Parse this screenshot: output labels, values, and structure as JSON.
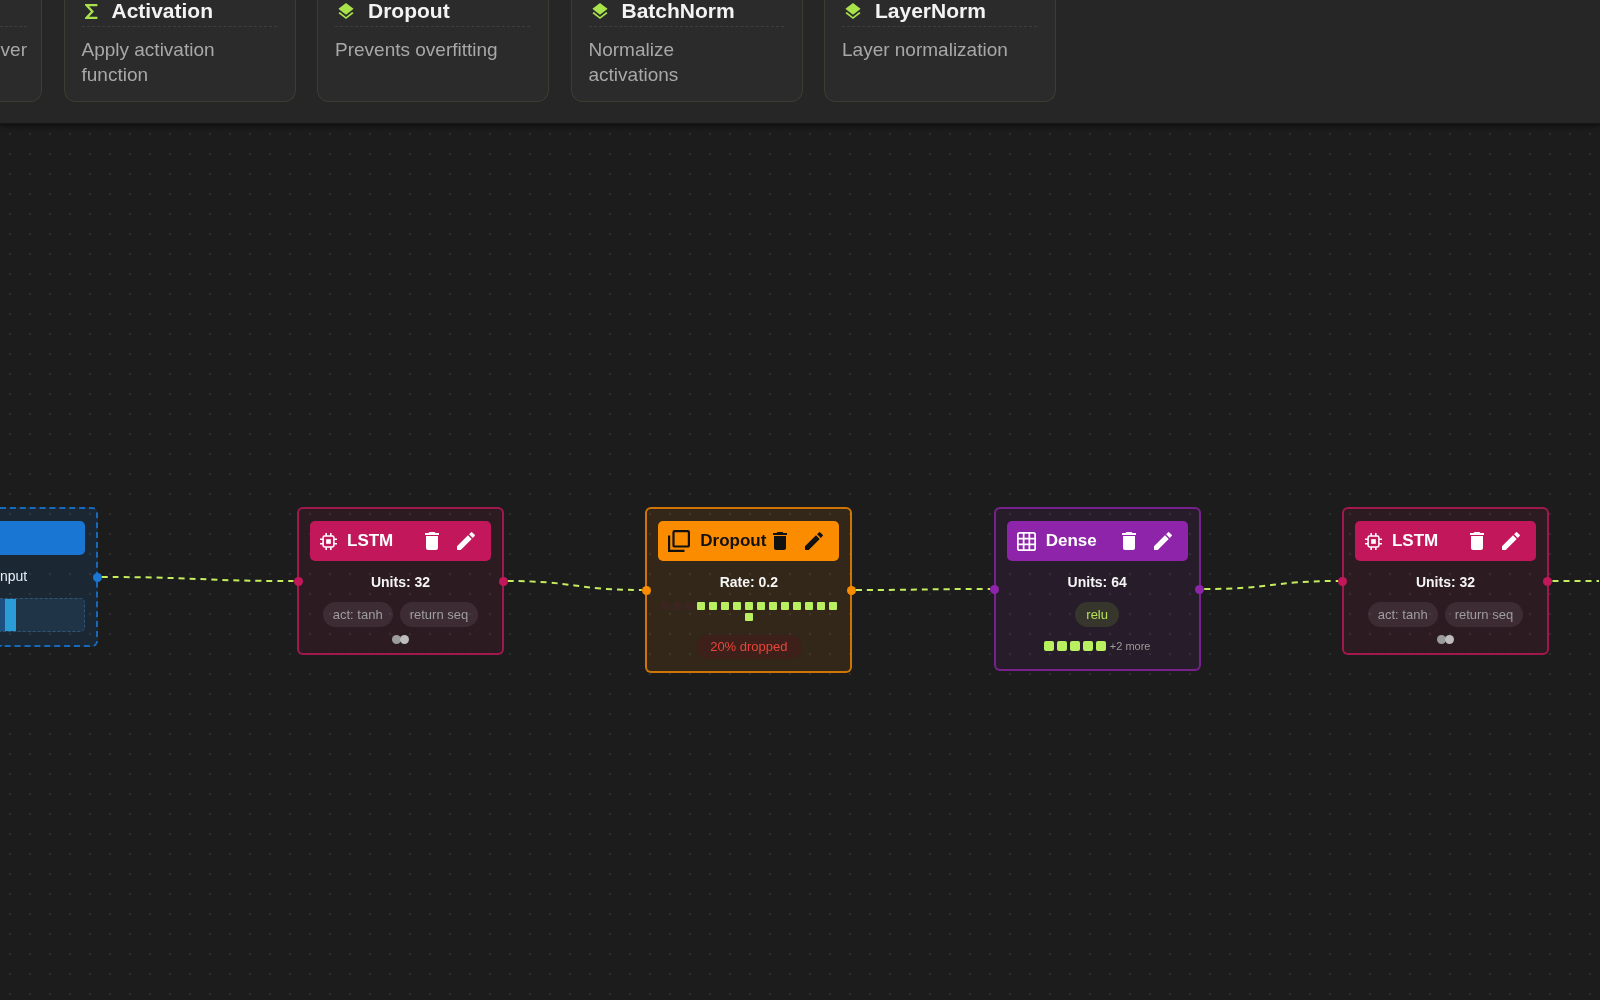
{
  "palette": {
    "partial_card": {
      "description": "ver"
    },
    "cards": [
      {
        "kind": "function",
        "title": "Activation",
        "description": "Apply activation function"
      },
      {
        "kind": "layer",
        "title": "Dropout",
        "description": "Prevents overfitting"
      },
      {
        "kind": "layer",
        "title": "BatchNorm",
        "description": "Normalize activations"
      },
      {
        "kind": "layer",
        "title": "LayerNorm",
        "description": "Layer normalization"
      }
    ]
  },
  "nodes": [
    {
      "kind": "input",
      "color": "#1976d2",
      "label": "nput",
      "connected_out": true
    },
    {
      "kind": "recurrent",
      "color": "#c2185b",
      "title": "LSTM",
      "param": "Units: 32",
      "tags": [
        "act: tanh",
        "return seq"
      ],
      "connected_out": true
    },
    {
      "kind": "dropout",
      "color": "#fb8c00",
      "title": "Dropout",
      "param": "Rate: 0.2",
      "units": [
        {
          "dropped": true
        },
        {
          "dropped": true
        },
        {
          "dropped": true
        },
        {
          "dropped": false
        },
        {
          "dropped": false
        },
        {
          "dropped": false
        },
        {
          "dropped": false
        },
        {
          "dropped": false
        },
        {
          "dropped": false
        },
        {
          "dropped": false
        },
        {
          "dropped": false
        },
        {
          "dropped": false
        },
        {
          "dropped": false
        },
        {
          "dropped": false
        },
        {
          "dropped": false
        },
        {
          "dropped": false
        }
      ],
      "badge": "20% dropped",
      "connected_out": true
    },
    {
      "kind": "dense",
      "color": "#8e24aa",
      "title": "Dense",
      "param": "Units: 64",
      "tags": [
        "relu"
      ],
      "units": [
        {
          "dropped": false
        },
        {
          "dropped": false
        },
        {
          "dropped": false
        },
        {
          "dropped": false
        },
        {
          "dropped": false
        }
      ],
      "more": "+2 more",
      "connected_out": true
    },
    {
      "kind": "recurrent",
      "color": "#c2185b",
      "title": "LSTM",
      "param": "Units: 32",
      "tags": [
        "act: tanh",
        "return seq"
      ],
      "connected_out": true
    }
  ]
}
